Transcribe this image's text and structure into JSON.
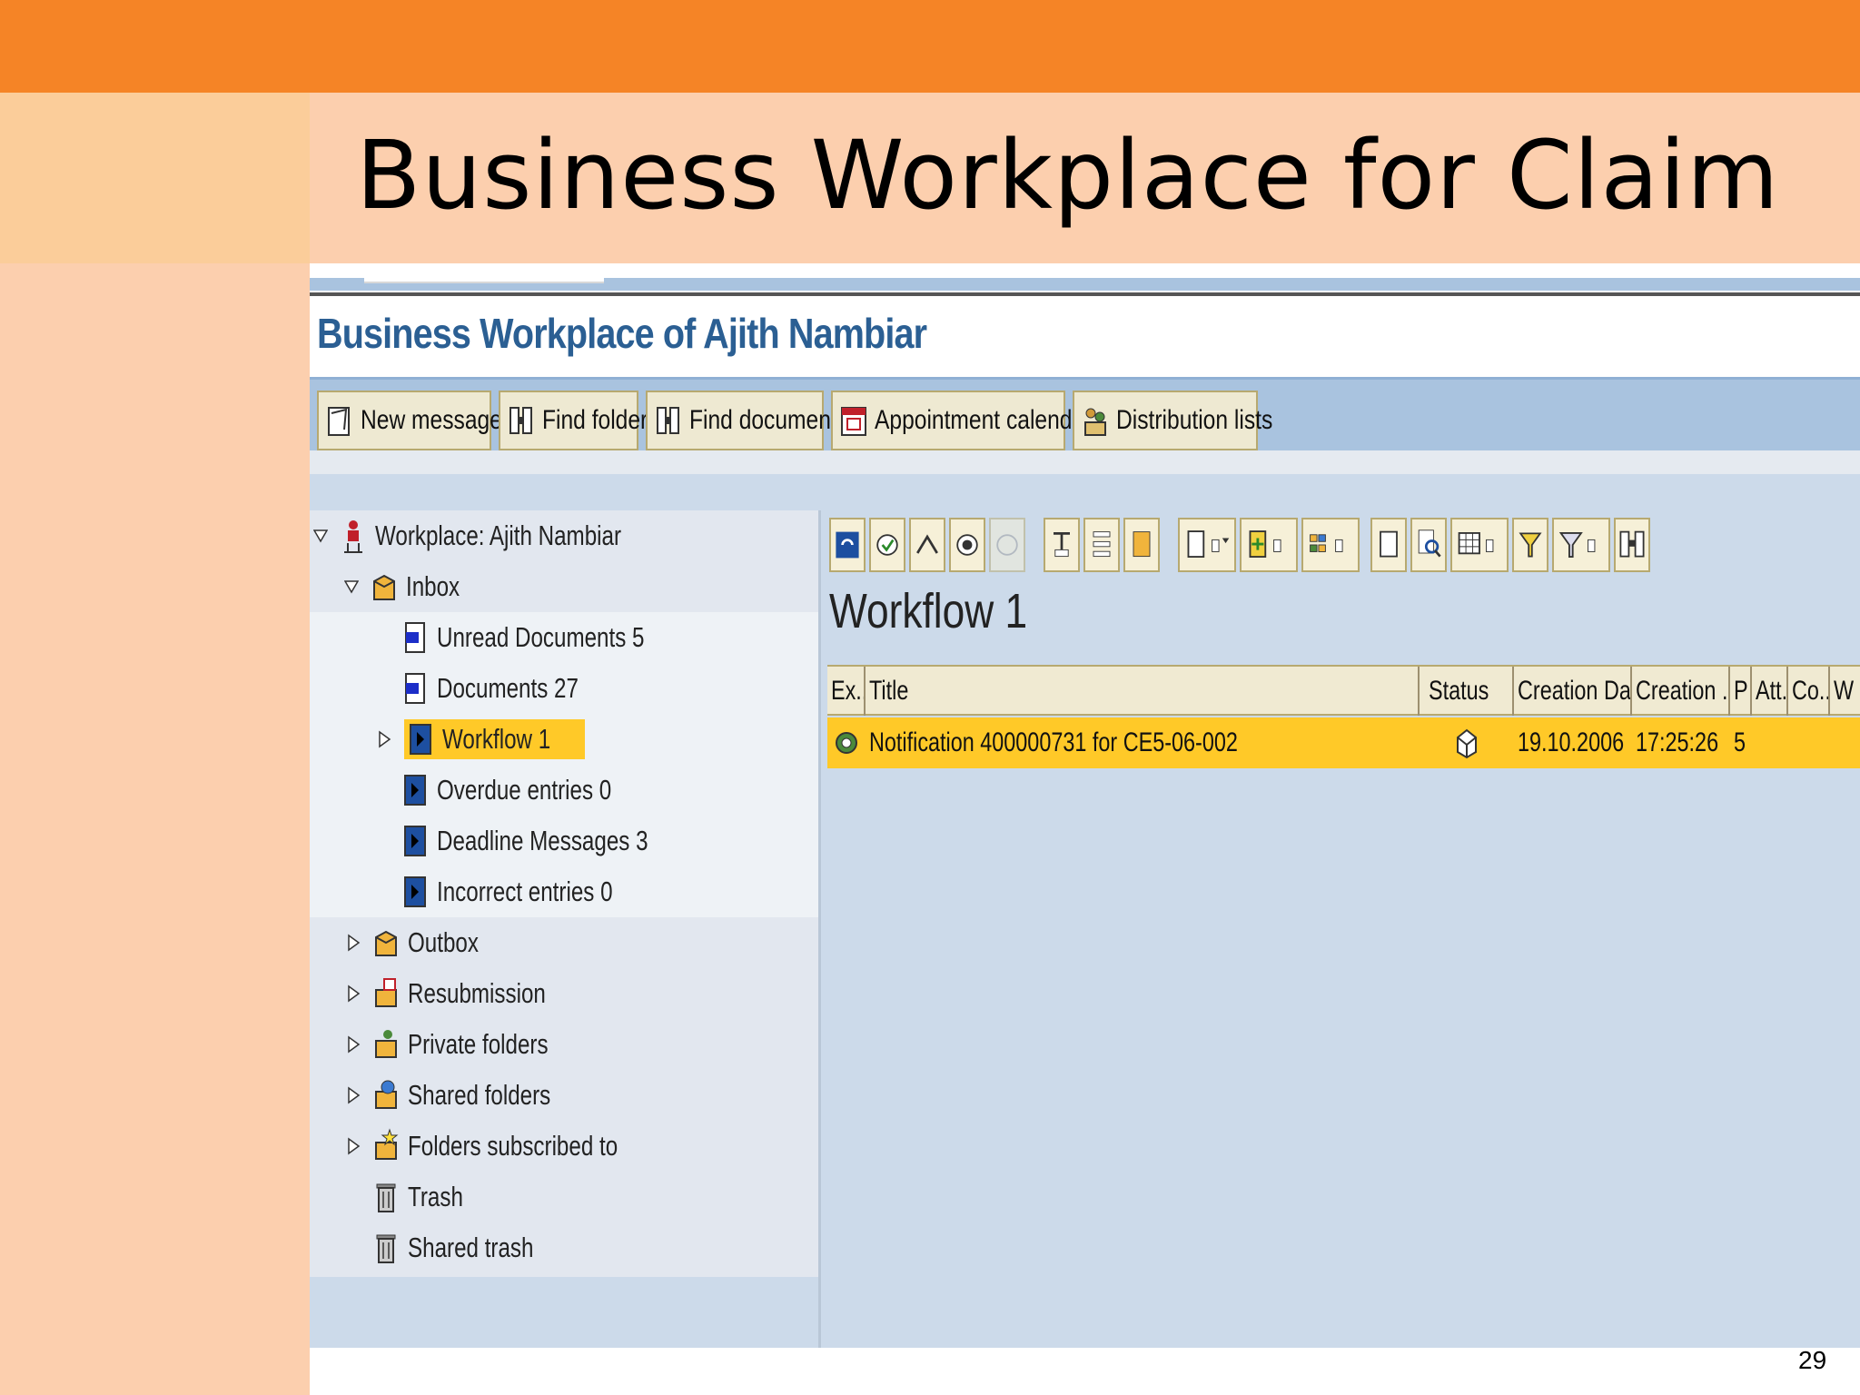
{
  "slide": {
    "title": "Business Workplace for Claim",
    "page_number": "29"
  },
  "sap": {
    "title": "Business Workplace of Ajith Nambiar",
    "toolbar": [
      {
        "label": "New message",
        "icon": "new-message-icon"
      },
      {
        "label": "Find folder",
        "icon": "binoculars-icon"
      },
      {
        "label": "Find document",
        "icon": "binoculars-icon"
      },
      {
        "label": "Appointment calendar",
        "icon": "calendar-icon"
      },
      {
        "label": "Distribution lists",
        "icon": "distribution-list-icon"
      }
    ],
    "tree": {
      "root": "Workplace: Ajith Nambiar",
      "inbox": "Inbox",
      "inbox_items": [
        {
          "label": "Unread Documents 5"
        },
        {
          "label": "Documents 27"
        },
        {
          "label": "Workflow 1",
          "selected": true
        },
        {
          "label": "Overdue entries 0"
        },
        {
          "label": "Deadline Messages 3"
        },
        {
          "label": "Incorrect entries 0"
        }
      ],
      "folders": [
        {
          "label": "Outbox"
        },
        {
          "label": "Resubmission"
        },
        {
          "label": "Private folders"
        },
        {
          "label": "Shared folders"
        },
        {
          "label": "Folders subscribed to"
        },
        {
          "label": "Trash"
        },
        {
          "label": "Shared trash"
        }
      ]
    },
    "right": {
      "heading": "Workflow 1",
      "columns": [
        "Ex...",
        "Title",
        "Status",
        "Creation Da...",
        "Creation ...",
        "P",
        "Att...",
        "Co...",
        "W"
      ],
      "row": {
        "title": "Notification 400000731 for CE5-06-002",
        "date": "19.10.2006",
        "time": "17:25:26",
        "priority": "5"
      }
    },
    "colors": {
      "accent_orange": "#f58426",
      "selection_yellow": "#ffc928",
      "sap_blue": "#2b5f93"
    }
  }
}
